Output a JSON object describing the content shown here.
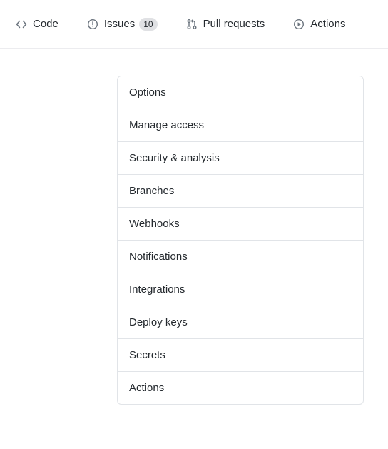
{
  "nav": {
    "code": "Code",
    "issues": "Issues",
    "issues_count": "10",
    "pull_requests": "Pull requests",
    "actions": "Actions"
  },
  "sidebar": {
    "items": [
      {
        "label": "Options"
      },
      {
        "label": "Manage access"
      },
      {
        "label": "Security & analysis"
      },
      {
        "label": "Branches"
      },
      {
        "label": "Webhooks"
      },
      {
        "label": "Notifications"
      },
      {
        "label": "Integrations"
      },
      {
        "label": "Deploy keys"
      },
      {
        "label": "Secrets"
      },
      {
        "label": "Actions"
      }
    ],
    "selected_index": 8
  }
}
